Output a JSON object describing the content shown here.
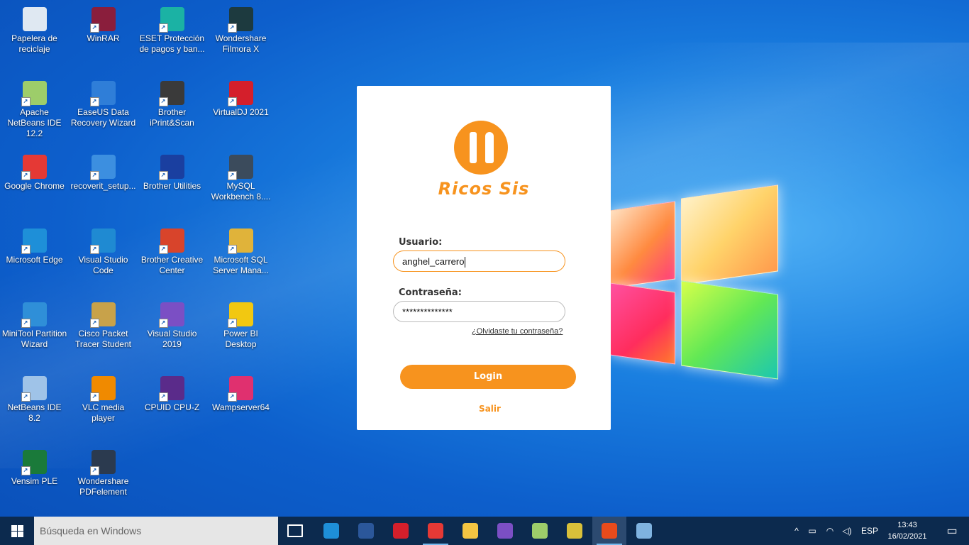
{
  "desktop": {
    "icons": [
      {
        "label": "Papelera de reciclaje",
        "icon": "recycle-bin-icon",
        "color": "#dfe8f2"
      },
      {
        "label": "WinRAR",
        "icon": "winrar-icon",
        "color": "#8a1e3c"
      },
      {
        "label": "ESET Protección de pagos y ban...",
        "icon": "eset-icon",
        "color": "#1bb2a4"
      },
      {
        "label": "Wondershare Filmora X",
        "icon": "filmora-icon",
        "color": "#1d3a3f"
      },
      {
        "label": "Apache NetBeans IDE 12.2",
        "icon": "netbeans-icon",
        "color": "#9dcd6a"
      },
      {
        "label": "EaseUS Data Recovery Wizard",
        "icon": "easeus-icon",
        "color": "#2f7ed8"
      },
      {
        "label": "Brother iPrint&Scan",
        "icon": "printer-icon",
        "color": "#3a3a3a"
      },
      {
        "label": "VirtualDJ 2021",
        "icon": "virtualdj-icon",
        "color": "#d41f2b"
      },
      {
        "label": "Google Chrome",
        "icon": "chrome-icon",
        "color": "#e53935"
      },
      {
        "label": "recoverit_setup...",
        "icon": "setup-icon",
        "color": "#3c8fe0"
      },
      {
        "label": "Brother Utilities",
        "icon": "brother-utilities-icon",
        "color": "#1a3fa0"
      },
      {
        "label": "MySQL Workbench 8....",
        "icon": "mysql-icon",
        "color": "#3b4b5c"
      },
      {
        "label": "Microsoft Edge",
        "icon": "edge-icon",
        "color": "#1e8fd8"
      },
      {
        "label": "Visual Studio Code",
        "icon": "vscode-icon",
        "color": "#1f8ad2"
      },
      {
        "label": "Brother Creative Center",
        "icon": "creative-center-icon",
        "color": "#d8442b"
      },
      {
        "label": "Microsoft SQL Server Mana...",
        "icon": "sql-server-icon",
        "color": "#e0b33a"
      },
      {
        "label": "MiniTool Partition Wizard",
        "icon": "minitool-icon",
        "color": "#2f8fd8"
      },
      {
        "label": "Cisco Packet Tracer Student",
        "icon": "packet-tracer-icon",
        "color": "#c8a24a"
      },
      {
        "label": "Visual Studio 2019",
        "icon": "visual-studio-icon",
        "color": "#7b4fc4"
      },
      {
        "label": "Power BI Desktop",
        "icon": "powerbi-icon",
        "color": "#f2c811"
      },
      {
        "label": "NetBeans IDE 8.2",
        "icon": "netbeans-cube-icon",
        "color": "#9fc3e8"
      },
      {
        "label": "VLC media player",
        "icon": "vlc-icon",
        "color": "#f08a00"
      },
      {
        "label": "CPUID CPU-Z",
        "icon": "cpuz-icon",
        "color": "#5a2b8a"
      },
      {
        "label": "Wampserver64",
        "icon": "wamp-icon",
        "color": "#e0306f"
      },
      {
        "label": "Vensim PLE",
        "icon": "vensim-icon",
        "color": "#1a7a3a"
      },
      {
        "label": "Wondershare PDFelement",
        "icon": "pdfelement-icon",
        "color": "#2b3a4f"
      }
    ]
  },
  "login": {
    "brand": "Ricos Sis",
    "user_label": "Usuario:",
    "user_value": "anghel_carrero",
    "password_label": "Contraseña:",
    "password_value": "**************",
    "forgot_link": "¿Olvidaste tu contraseña?",
    "login_button": "Login",
    "exit_link": "Salir",
    "accent": "#f7931e"
  },
  "taskbar": {
    "search_placeholder": "Búsqueda en Windows",
    "apps": [
      {
        "icon": "task-view-icon",
        "color": "#0c2a4e"
      },
      {
        "icon": "edge-icon",
        "color": "#1e8fd8"
      },
      {
        "icon": "word-icon",
        "color": "#2b579a"
      },
      {
        "icon": "virtualdj-icon",
        "color": "#d41f2b"
      },
      {
        "icon": "chrome-icon",
        "color": "#e53935"
      },
      {
        "icon": "file-explorer-icon",
        "color": "#f4c542"
      },
      {
        "icon": "visual-studio-icon",
        "color": "#7b4fc4"
      },
      {
        "icon": "netbeans-icon",
        "color": "#9dcd6a"
      },
      {
        "icon": "packet-tracer-icon",
        "color": "#d8c03a"
      },
      {
        "icon": "java-app-icon",
        "color": "#e84b1c"
      },
      {
        "icon": "paint-icon",
        "color": "#7fb3e0"
      }
    ],
    "language": "ESP",
    "time": "13:43",
    "date": "16/02/2021"
  }
}
